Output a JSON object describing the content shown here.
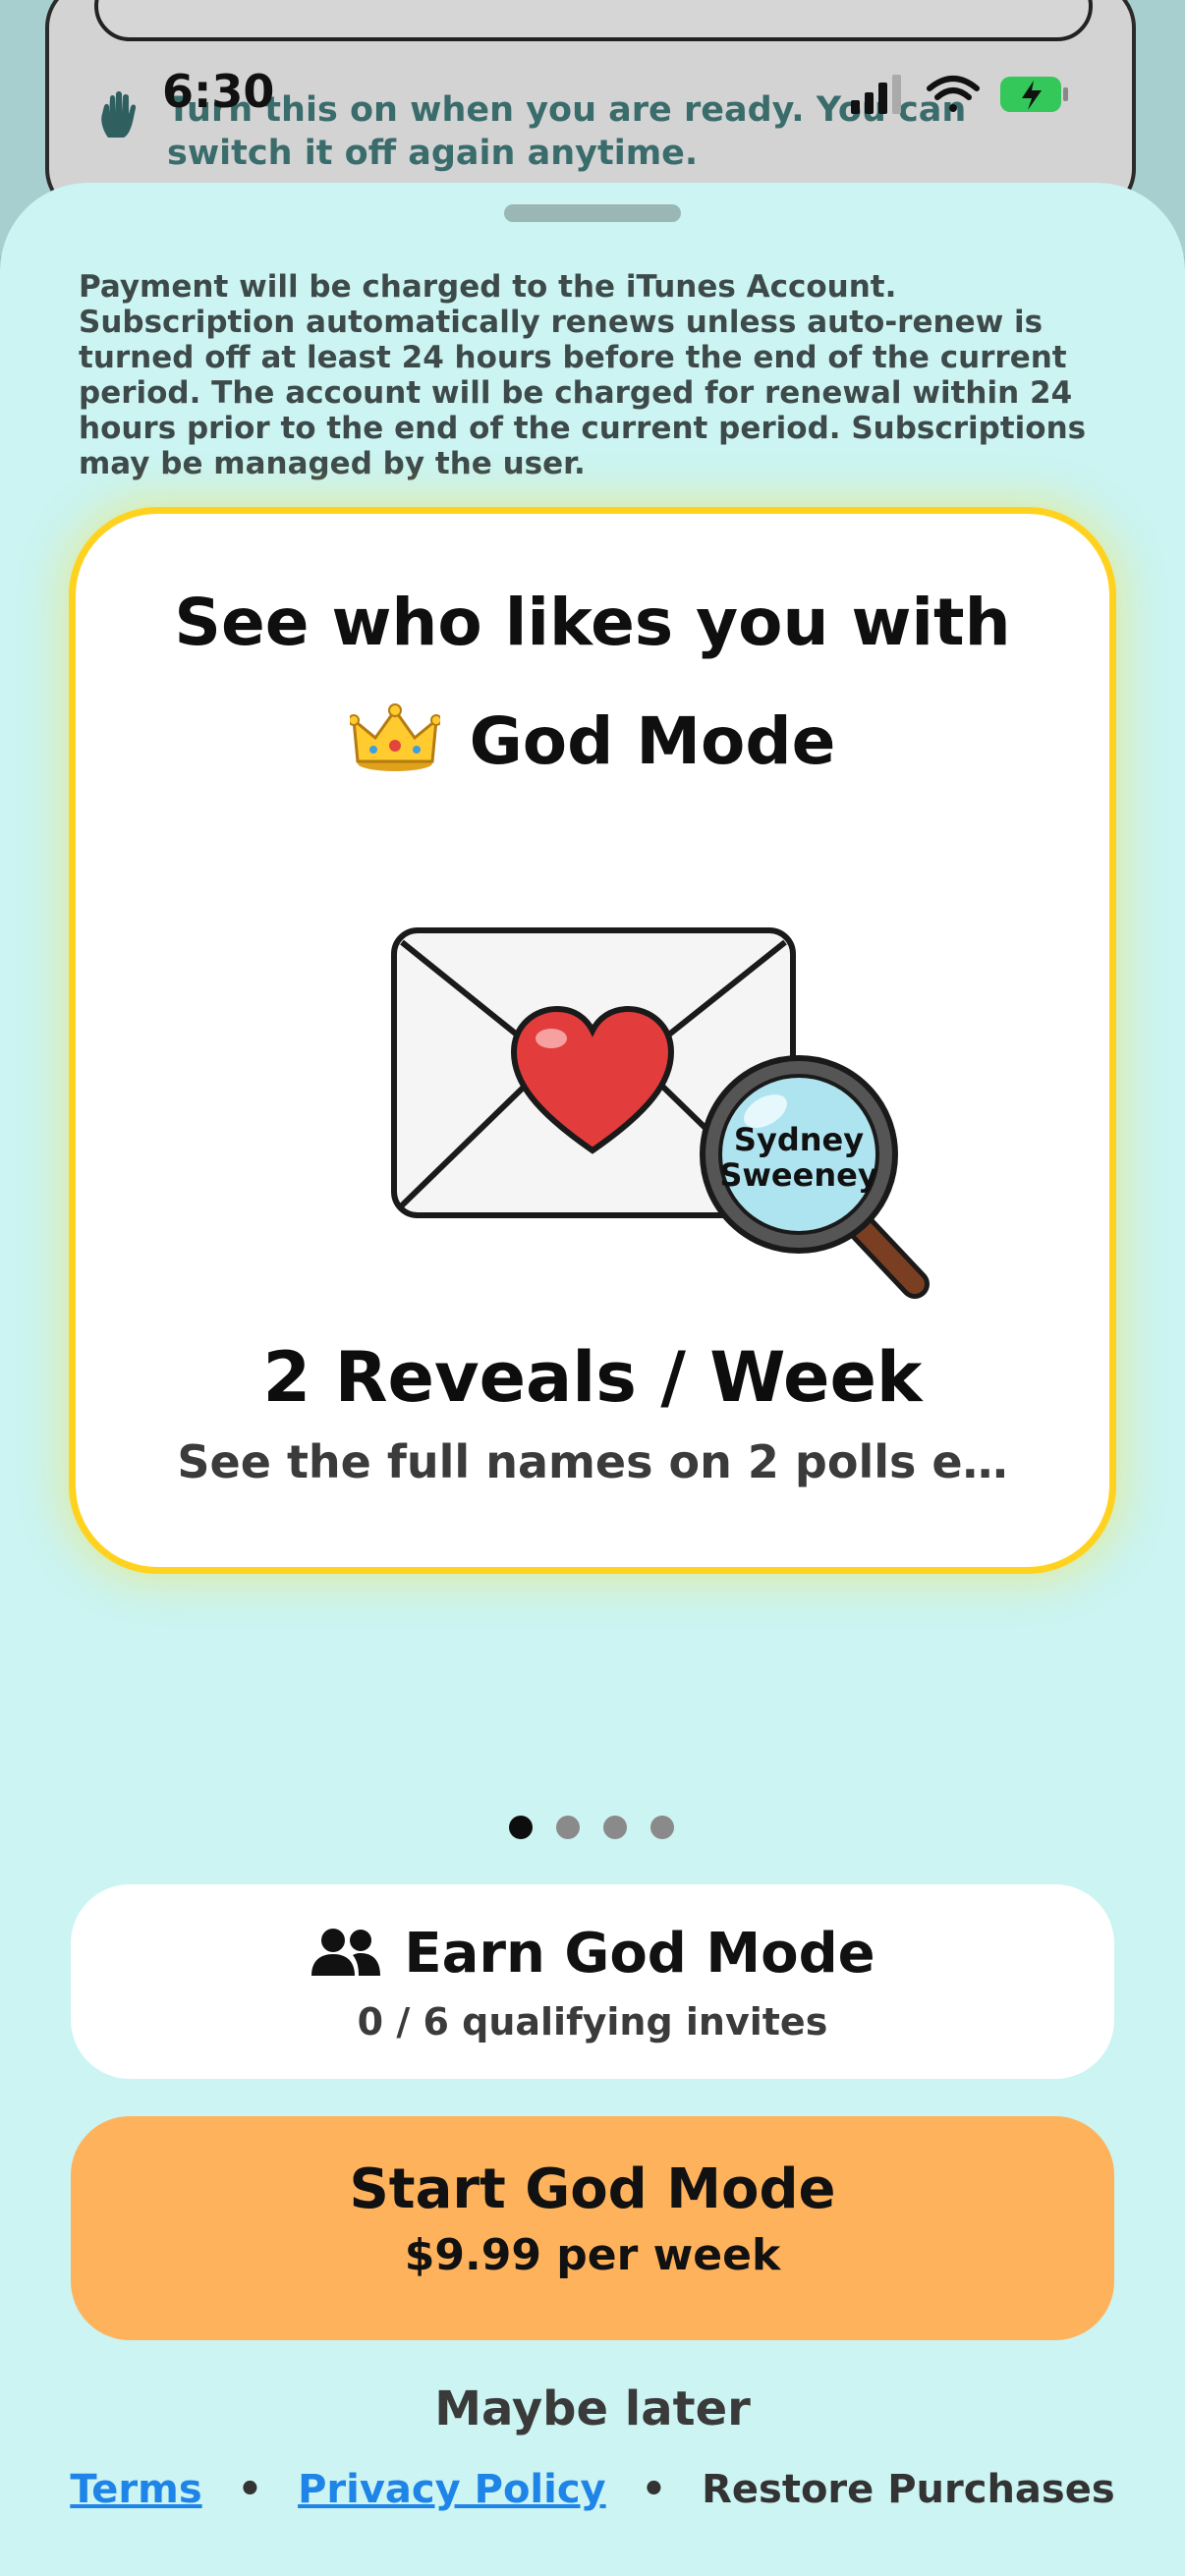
{
  "status_bar": {
    "time": "6:30"
  },
  "background": {
    "hint_text": "Turn this on when you are ready. You can switch it off again anytime."
  },
  "legal_text": "Payment will be charged to the iTunes Account. Subscription automatically renews unless auto-renew is turned off at least 24 hours before the end of the current period. The account will be charged for renewal within 24 hours prior to the end of the current period. Subscriptions may be managed by the user.",
  "feature_card": {
    "title_line1": "See who likes you with",
    "title_line2": "God Mode",
    "magnifier_name_line1": "Sydney",
    "magnifier_name_line2": "Sweeney",
    "headline": "2 Reveals / Week",
    "subtitle": "See the full names on 2 polls e…"
  },
  "pager": {
    "count": 4,
    "active_index": 0
  },
  "earn": {
    "title": "Earn God Mode",
    "progress_text": "0 / 6 qualifying invites",
    "icon": "people-icon"
  },
  "cta": {
    "title": "Start God Mode",
    "price": "$9.99 per week"
  },
  "maybe_later": "Maybe later",
  "footer": {
    "terms": "Terms",
    "separator": "•",
    "privacy": "Privacy Policy",
    "restore": "Restore Purchases"
  },
  "colors": {
    "sheet_bg": "#cbf4f2",
    "card_border": "#ffd21f",
    "cta_bg": "#ffb25c",
    "link": "#1f84e8"
  }
}
